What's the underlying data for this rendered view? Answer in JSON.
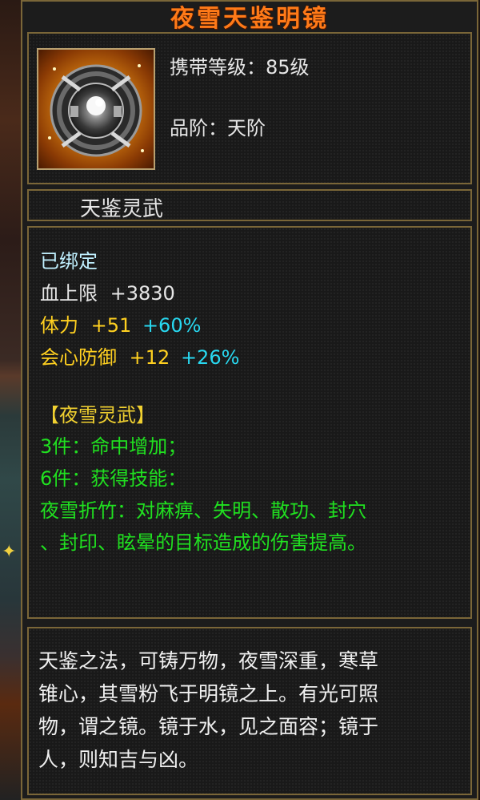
{
  "item": {
    "name": "夜雪天鉴明镜",
    "carry_level_label": "携带等级：85级",
    "grade_label": "品阶：天阶",
    "category": "天鉴灵武",
    "bound": "已绑定",
    "stats": [
      {
        "name": "血上限",
        "value": "+3830",
        "percent": ""
      },
      {
        "name": "体力",
        "value": "+51",
        "percent": "+60%"
      },
      {
        "name": "会心防御",
        "value": "+12",
        "percent": "+26%"
      }
    ],
    "set_name": "【夜雪灵武】",
    "set_bonus_3": "3件：命中增加；",
    "set_bonus_6": "6件：获得技能：",
    "set_skill_line1": "夜雪折竹：对麻痹、失明、散功、封穴",
    "set_skill_line2": "、封印、眩晕的目标造成的伤害提高。",
    "lore_lines": [
      "天鉴之法，可铸万物，夜雪深重，寒草",
      "锥心，其雪粉飞于明镜之上。有光可照",
      "物，谓之镜。镜于水，见之面容；镜于",
      "人，则知吉与凶。"
    ]
  },
  "colors": {
    "title": "#ff7a18",
    "border": "#7a6638",
    "stat_yellow": "#ffd020",
    "stat_percent": "#28d8f0",
    "set_green": "#20e020"
  },
  "icons": {
    "item_icon": "mirror-disc-icon"
  }
}
